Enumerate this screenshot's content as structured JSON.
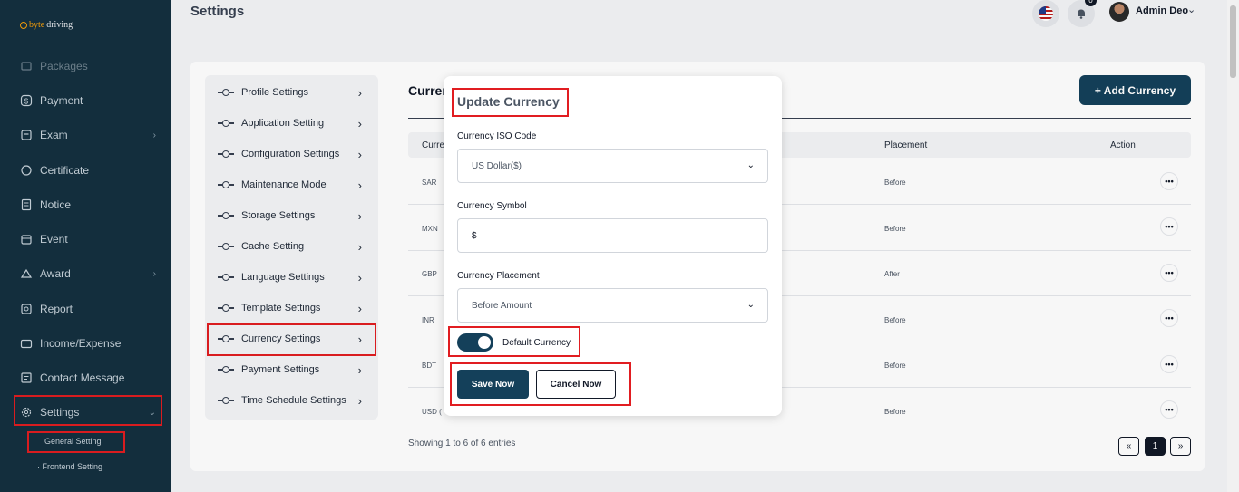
{
  "brand": {
    "logo_prefix": "byte",
    "logo_suffix": "driving"
  },
  "sidebar": {
    "items": [
      {
        "label": "Packages",
        "icon": "package-icon"
      },
      {
        "label": "Payment",
        "icon": "dollar-icon"
      },
      {
        "label": "Exam",
        "icon": "exam-icon"
      },
      {
        "label": "Certificate",
        "icon": "certificate-icon"
      },
      {
        "label": "Notice",
        "icon": "notice-icon"
      },
      {
        "label": "Event",
        "icon": "calendar-icon"
      },
      {
        "label": "Award",
        "icon": "award-icon"
      },
      {
        "label": "Report",
        "icon": "report-icon"
      },
      {
        "label": "Income/Expense",
        "icon": "wallet-icon"
      },
      {
        "label": "Contact Message",
        "icon": "message-icon"
      },
      {
        "label": "Settings",
        "icon": "gear-icon"
      }
    ],
    "sub_items": [
      "General Setting",
      "Frontend Setting"
    ],
    "chevron": "›",
    "chevron_down": "⌄"
  },
  "header": {
    "title": "Settings",
    "notification_count": "0",
    "admin_name": "Admin Deo",
    "admin_chevron": "⌄"
  },
  "settings_menu": {
    "items": [
      "Profile Settings",
      "Application Setting",
      "Configuration Settings",
      "Maintenance Mode",
      "Storage Settings",
      "Cache Setting",
      "Language Settings",
      "Template Settings",
      "Currency Settings",
      "Payment Settings",
      "Time Schedule Settings"
    ],
    "arrow": "›"
  },
  "main": {
    "section_title": "Curren",
    "add_button": "+ Add Currency",
    "columns": {
      "col1": "Curre",
      "placement": "Placement",
      "action": "Action"
    },
    "rows": [
      {
        "code": "SAR",
        "placement": "Before"
      },
      {
        "code": "MXN",
        "placement": "Before"
      },
      {
        "code": "GBP",
        "placement": "After"
      },
      {
        "code": "INR",
        "placement": "Before"
      },
      {
        "code": "BDT",
        "placement": "Before"
      },
      {
        "code": "USD (",
        "placement": "Before"
      }
    ],
    "action_glyph": "•••",
    "showing": "Showing 1 to 6 of 6 entries",
    "pagination": {
      "prev": "«",
      "current": "1",
      "next": "»"
    }
  },
  "modal": {
    "title": "Update Currency",
    "iso_label": "Currency ISO Code",
    "iso_value": "US Dollar($)",
    "symbol_label": "Currency Symbol",
    "symbol_value": "$",
    "placement_label": "Currency Placement",
    "placement_value": "Before Amount",
    "dropdown_glyph": "⌄",
    "default_label": "Default Currency",
    "default_on": true,
    "save_label": "Save Now",
    "cancel_label": "Cancel Now"
  },
  "colors": {
    "sidebar_bg": "#14303f",
    "primary": "#14405a",
    "highlight": "#e11d21"
  }
}
